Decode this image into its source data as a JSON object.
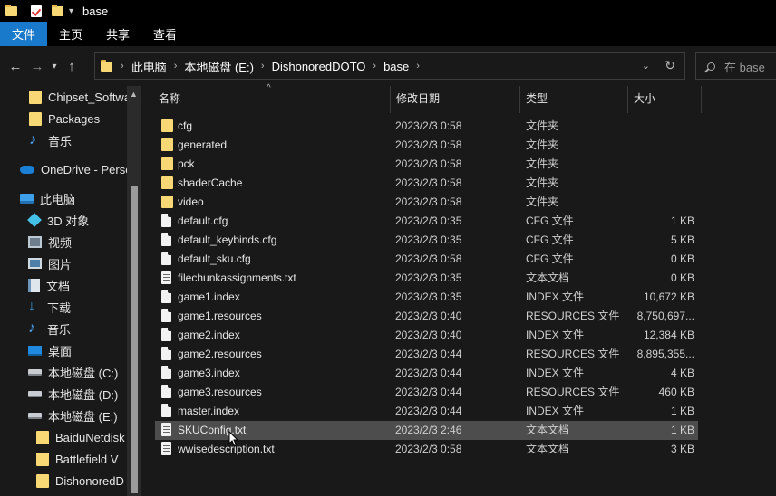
{
  "window": {
    "title": "base"
  },
  "ribbon": {
    "tabs": [
      "文件",
      "主页",
      "共享",
      "查看"
    ]
  },
  "address": {
    "crumbs": [
      "此电脑",
      "本地磁盘 (E:)",
      "DishonoredDOTO",
      "base"
    ]
  },
  "search": {
    "placeholder": "在 base"
  },
  "nav": {
    "items": [
      {
        "label": "Chipset_Softwa",
        "icon": "folder-icon"
      },
      {
        "label": "Packages",
        "icon": "folder-icon"
      },
      {
        "label": "音乐",
        "icon": "music-icon"
      },
      {
        "label": "OneDrive - Perso",
        "icon": "cloud-icon"
      },
      {
        "label": "此电脑",
        "icon": "computer-icon"
      },
      {
        "label": "3D 对象",
        "icon": "cube-icon"
      },
      {
        "label": "视频",
        "icon": "video-icon"
      },
      {
        "label": "图片",
        "icon": "picture-icon"
      },
      {
        "label": "文档",
        "icon": "document-icon"
      },
      {
        "label": "下载",
        "icon": "download-icon"
      },
      {
        "label": "音乐",
        "icon": "music-icon"
      },
      {
        "label": "桌面",
        "icon": "desktop-icon"
      },
      {
        "label": "本地磁盘 (C:)",
        "icon": "drive-icon"
      },
      {
        "label": "本地磁盘 (D:)",
        "icon": "drive-icon"
      },
      {
        "label": "本地磁盘 (E:)",
        "icon": "drive-icon"
      },
      {
        "label": "BaiduNetdisk",
        "icon": "folder-icon"
      },
      {
        "label": "Battlefield V",
        "icon": "folder-icon"
      },
      {
        "label": "DishonoredD",
        "icon": "folder-icon"
      }
    ]
  },
  "columns": {
    "name": "名称",
    "date": "修改日期",
    "type": "类型",
    "size": "大小"
  },
  "files": [
    {
      "name": "cfg",
      "date": "2023/2/3 0:58",
      "type": "文件夹",
      "size": "",
      "kind": "folder"
    },
    {
      "name": "generated",
      "date": "2023/2/3 0:58",
      "type": "文件夹",
      "size": "",
      "kind": "folder"
    },
    {
      "name": "pck",
      "date": "2023/2/3 0:58",
      "type": "文件夹",
      "size": "",
      "kind": "folder"
    },
    {
      "name": "shaderCache",
      "date": "2023/2/3 0:58",
      "type": "文件夹",
      "size": "",
      "kind": "folder"
    },
    {
      "name": "video",
      "date": "2023/2/3 0:58",
      "type": "文件夹",
      "size": "",
      "kind": "folder"
    },
    {
      "name": "default.cfg",
      "date": "2023/2/3 0:35",
      "type": "CFG 文件",
      "size": "1 KB",
      "kind": "file"
    },
    {
      "name": "default_keybinds.cfg",
      "date": "2023/2/3 0:35",
      "type": "CFG 文件",
      "size": "5 KB",
      "kind": "file"
    },
    {
      "name": "default_sku.cfg",
      "date": "2023/2/3 0:58",
      "type": "CFG 文件",
      "size": "0 KB",
      "kind": "file"
    },
    {
      "name": "filechunkassignments.txt",
      "date": "2023/2/3 0:35",
      "type": "文本文档",
      "size": "0 KB",
      "kind": "txt"
    },
    {
      "name": "game1.index",
      "date": "2023/2/3 0:35",
      "type": "INDEX 文件",
      "size": "10,672 KB",
      "kind": "file"
    },
    {
      "name": "game1.resources",
      "date": "2023/2/3 0:40",
      "type": "RESOURCES 文件",
      "size": "8,750,697...",
      "kind": "file"
    },
    {
      "name": "game2.index",
      "date": "2023/2/3 0:40",
      "type": "INDEX 文件",
      "size": "12,384 KB",
      "kind": "file"
    },
    {
      "name": "game2.resources",
      "date": "2023/2/3 0:44",
      "type": "RESOURCES 文件",
      "size": "8,895,355...",
      "kind": "file"
    },
    {
      "name": "game3.index",
      "date": "2023/2/3 0:44",
      "type": "INDEX 文件",
      "size": "4 KB",
      "kind": "file"
    },
    {
      "name": "game3.resources",
      "date": "2023/2/3 0:44",
      "type": "RESOURCES 文件",
      "size": "460 KB",
      "kind": "file"
    },
    {
      "name": "master.index",
      "date": "2023/2/3 0:44",
      "type": "INDEX 文件",
      "size": "1 KB",
      "kind": "file"
    },
    {
      "name": "SKUConfig.txt",
      "date": "2023/2/3 2:46",
      "type": "文本文档",
      "size": "1 KB",
      "kind": "txt",
      "selected": true
    },
    {
      "name": "wwisedescription.txt",
      "date": "2023/2/3 0:58",
      "type": "文本文档",
      "size": "3 KB",
      "kind": "txt"
    }
  ]
}
